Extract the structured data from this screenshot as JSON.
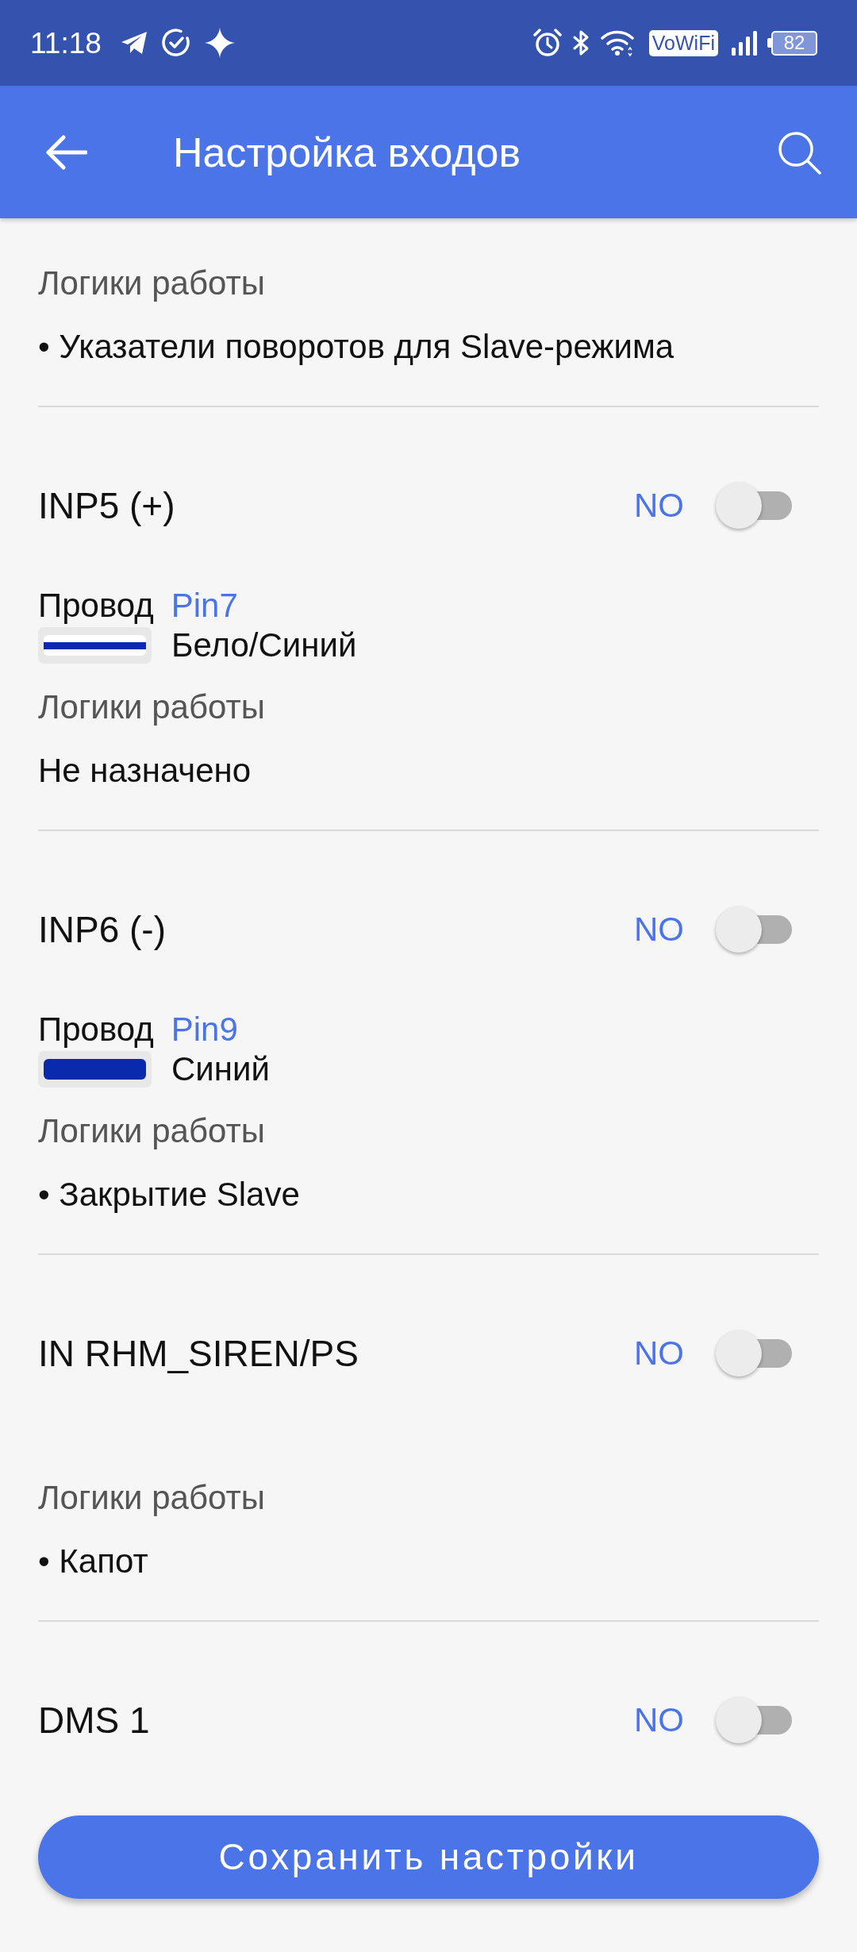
{
  "status_bar": {
    "time": "11:18",
    "network_badge": "VoWiFi",
    "battery": "82"
  },
  "app_bar": {
    "title": "Настройка входов"
  },
  "sections": [
    {
      "logic": {
        "label": "Логики работы",
        "items": [
          "• Указатели поворотов для Slave-режима"
        ]
      }
    },
    {
      "title": "INP5 (+)",
      "switch": {
        "label": "NO",
        "on": false
      },
      "wire": {
        "label": "Провод",
        "pin": "Pin7",
        "color_name": "Бело/Синий",
        "kind": "striped",
        "color": "#0a2aad"
      },
      "logic": {
        "label": "Логики работы",
        "items": [
          "Не назначено"
        ]
      }
    },
    {
      "title": "INP6 (-)",
      "switch": {
        "label": "NO",
        "on": false
      },
      "wire": {
        "label": "Провод",
        "pin": "Pin9",
        "color_name": "Синий",
        "kind": "solid",
        "color": "#0a2aad"
      },
      "logic": {
        "label": "Логики работы",
        "items": [
          "• Закрытие Slave"
        ]
      }
    },
    {
      "title": "IN RHM_SIREN/PS",
      "switch": {
        "label": "NO",
        "on": false
      },
      "logic": {
        "label": "Логики работы",
        "items": [
          "• Капот"
        ]
      }
    },
    {
      "title": "DMS 1",
      "switch": {
        "label": "NO",
        "on": false
      }
    }
  ],
  "save_button": {
    "label": "Сохранить настройки"
  }
}
